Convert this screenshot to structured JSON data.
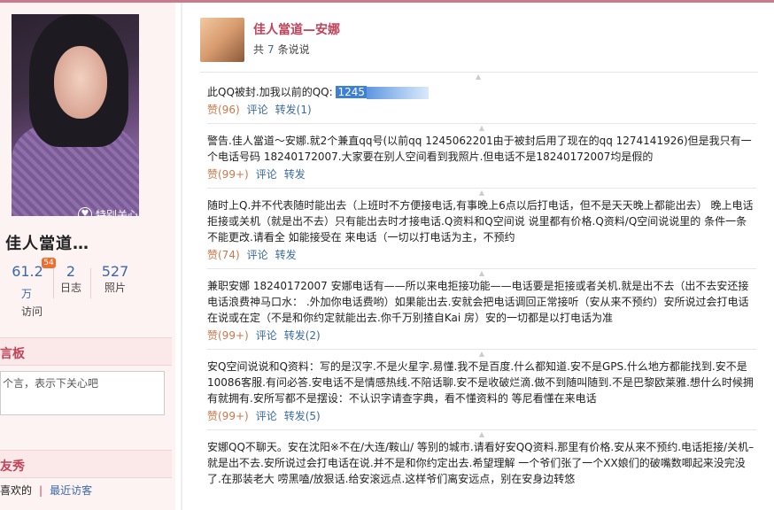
{
  "profile": {
    "name": "佳人當道…",
    "special_care_label": "特别关心",
    "stats": [
      {
        "value": "61.2",
        "unit": "万",
        "label": "访问",
        "badge": "54"
      },
      {
        "value": "2",
        "label": "日志"
      },
      {
        "value": "527",
        "label": "照片"
      }
    ]
  },
  "message_board": {
    "title": "言板",
    "placeholder": "个言，表示下关心吧"
  },
  "friends": {
    "title": "友秀",
    "tabs": [
      "喜欢的",
      "最近访客"
    ]
  },
  "feed": {
    "owner_name": "佳人當道—安娜",
    "count_prefix": "共",
    "count": "7",
    "count_suffix": "条说说",
    "posts": [
      {
        "text_before": "此QQ被封.加我以前的QQ: ",
        "highlight": "1245",
        "text_after": "",
        "like": "赞(96)",
        "comment": "评论",
        "forward": "转发(1)"
      },
      {
        "text_before": "警告.佳人當道～安娜.就2个兼直qq号(以前qq 1245062201由于被封后用了现在的qq 1274141926)但是我只有一个电话号码 18240172007.大家要在别人空间看到我照片.但电话不是18240172007均是假的",
        "like": "赞(99+)",
        "comment": "评论",
        "forward": "转发"
      },
      {
        "text_before": "随时上Q.并不代表随时能出去（上班时不方便接电话,有事晚上6点以后打电话，但不是天天晚上都能出去） 晚上电话拒接或关机（就是出不去）只有能出去时才接电话.Q资料和Q空间说 说里都有价格.Q资料/Q空间说说里的 条件一条不能更改.请看全 如能接受在 来电话（一切以打电话为主，不预约",
        "like": "赞(74)",
        "comment": "评论",
        "forward": "转发"
      },
      {
        "text_before": "兼职安娜 18240172007 安娜电话有——所以来电拒接功能——电话要是拒接或者关机.就是出不去（出不去安还接电话浪费神马口水： .外加你电话费哟）如果能出去.安就会把电话调回正常接听（安从来不预约）安所说过会打电话在说或在定（不是和你约定就能出去.你千万别揸自Kai 房）安的一切都是以打电话为准",
        "like": "赞(99+)",
        "comment": "评论",
        "forward": "转发(2)"
      },
      {
        "text_before": "安Q空间说说和Q资料：写的是汉字.不是火星字.易懂.我不是百度.什么都知道.安不是GPS.什么地方都能找到.安不是10086客服.有问必答.安电话不是情感热线.不陪话聊.安不是收破烂滴.做不到随叫随到.不是巴黎欧莱雅.想什么时候拥有就拥有.安所写都不是摆设：不认识字请查字典，看不懂资料的 等尼看懂在来电话",
        "like": "赞(99+)",
        "comment": "评论",
        "forward": "转发(5)"
      },
      {
        "text_before": "安娜QQ不聊天。安在沈阳※不在/大连/鞍山/ 等别的城市.请看好安QQ资料.那里有价格.安从来不预约.电话拒接/关机–就是出不去.安所说过会打电话在说.并不是和你约定出去.希望理解 一个爷们张了一个XX娘们的破嘴数唧起来没完没了.在那装老大 唠黑嗑/放狠话.给安滚远点.这样爷们离安远点，别在安身边转悠",
        "like": "",
        "comment": "",
        "forward": ""
      }
    ]
  }
}
